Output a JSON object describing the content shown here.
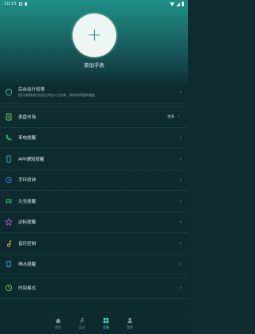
{
  "status": {
    "time": "10:15"
  },
  "header": {
    "add_label": "添加手表"
  },
  "list": {
    "items": [
      {
        "label": "后台运行权限",
        "sub": "提示请保持后台运行并加入白名单，保持时间更新速度"
      },
      {
        "label": "表盘市场",
        "right_text": "更多"
      },
      {
        "label": "来电提醒"
      },
      {
        "label": "APP通知提醒"
      },
      {
        "label": "手环闹钟"
      },
      {
        "label": "久坐提醒"
      },
      {
        "label": "达标提醒"
      },
      {
        "label": "音乐控制"
      },
      {
        "label": "喝水提醒"
      },
      {
        "label": "时间格式"
      }
    ]
  },
  "bottom_nav": {
    "items": [
      {
        "label": "首页"
      },
      {
        "label": "运动"
      },
      {
        "label": "设备"
      },
      {
        "label": "我的"
      }
    ]
  },
  "colors": {
    "accent": "#4ad8c9",
    "header_top": "#1f8f88",
    "bg": "#0e2b2f"
  }
}
